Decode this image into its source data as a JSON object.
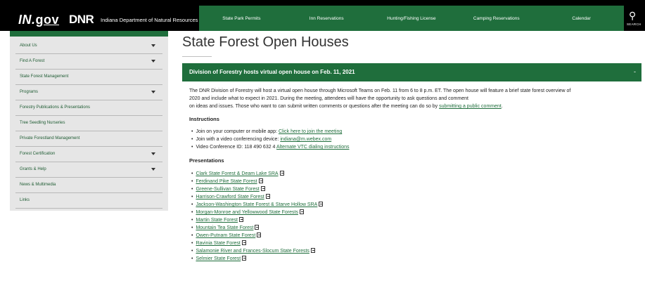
{
  "header": {
    "ingov_in": "IN.",
    "ingov_gov": "gov",
    "dnr_logo": "DNR",
    "agency": "Indiana Department of Natural Resources",
    "nav": [
      "State Park Permits",
      "Inn Reservations",
      "Hunting/Fishing License",
      "Camping Reservations",
      "Calendar"
    ],
    "search_label": "SEARCH"
  },
  "sidebar": {
    "items": [
      {
        "label": "About Us",
        "caret": true
      },
      {
        "label": "Find A Forest",
        "caret": true
      },
      {
        "label": "State Forest Management",
        "caret": false
      },
      {
        "label": "Programs",
        "caret": true
      },
      {
        "label": "Forestry Publications & Presentations",
        "caret": false
      },
      {
        "label": "Tree Seedling Nurseries",
        "caret": false
      },
      {
        "label": "Private Forestland Management",
        "caret": false
      },
      {
        "label": "Forest Certification",
        "caret": true
      },
      {
        "label": "Grants & Help",
        "caret": true
      },
      {
        "label": "News & Multimedia",
        "caret": false
      },
      {
        "label": "Links",
        "caret": false
      }
    ]
  },
  "main": {
    "title": "State Forest Open Houses",
    "banner_title": "Division of Forestry hosts virtual open house on Feb. 11, 2021",
    "banner_toggle": "-",
    "intro_1": "The DNR Division of Forestry will host a virtual open house through Microsoft Teams on Feb. 11 from 6 to 8 p.m. ET. The open house will feature a brief state forest overview of",
    "intro_2": "2020 and include what to expect in 2021. During the meeting, attendees will have the opportunity to ask questions and comment",
    "intro_3": "on ideas and issues. Those who want to can submit written comments or questions after the meeting can do so by ",
    "intro_link": "submitting a public comment",
    "intro_end": ".",
    "instructions_heading": "Instructions",
    "instructions": {
      "join_app_text": "Join on your computer or mobile app: ",
      "join_app_link": "Click here to join the meeting",
      "video_text": "Join with a video conferencing device: ",
      "video_link": "indiana@m.webex.com",
      "vc_text": "Video Conference ID: 118 490 632 4 ",
      "vc_link": "Alternate VTC dialing instructions"
    },
    "presentations_heading": "Presentations",
    "presentations": [
      "Clark State Forest & Deam Lake SRA",
      "Ferdinand Pike State Forest",
      "Greene-Sullivan State Forest",
      "Harrison-Crawford State Forest",
      "Jackson-Washington State Forest & Starve Hollow SRA",
      "Morgan-Monroe and Yellowwood State Forests",
      "Martin State Forest",
      "Mountain Tea State Forest",
      "Owen-Putnam State Forest",
      "Ravinia State Forest",
      "Salamonie River and Frances-Slocum State Forests",
      "Selmier State Forest"
    ]
  },
  "colors": {
    "brand_green": "#1f6e3c",
    "header_black": "#000000",
    "sidebar_bg": "#e6e6e6"
  }
}
